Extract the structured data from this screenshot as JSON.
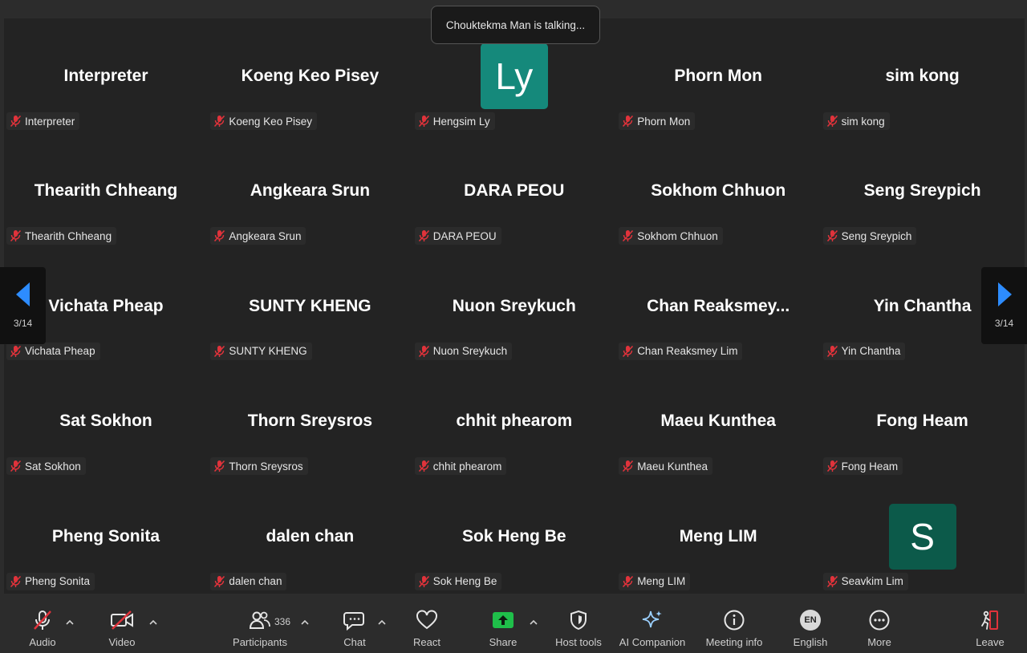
{
  "toast": {
    "text": "Chouktekma Man is talking..."
  },
  "nav": {
    "page_indicator": "3/14"
  },
  "participants": [
    {
      "display": "Interpreter",
      "tag": "Interpreter"
    },
    {
      "display": "Koeng Keo Pisey",
      "tag": "Koeng Keo Pisey"
    },
    {
      "display": "",
      "avatar": "Ly",
      "avatar_color": "#15897b",
      "tag": "Hengsim Ly"
    },
    {
      "display": "Phorn Mon",
      "tag": "Phorn Mon"
    },
    {
      "display": "sim kong",
      "tag": "sim kong"
    },
    {
      "display": "Thearith Chheang",
      "tag": "Thearith Chheang"
    },
    {
      "display": "Angkeara Srun",
      "tag": "Angkeara Srun"
    },
    {
      "display": "DARA PEOU",
      "tag": "DARA PEOU"
    },
    {
      "display": "Sokhom Chhuon",
      "tag": "Sokhom Chhuon"
    },
    {
      "display": "Seng Sreypich",
      "tag": "Seng Sreypich"
    },
    {
      "display": "Vichata Pheap",
      "tag": "Vichata Pheap"
    },
    {
      "display": "SUNTY KHENG",
      "tag": "SUNTY KHENG"
    },
    {
      "display": "Nuon Sreykuch",
      "tag": "Nuon Sreykuch"
    },
    {
      "display": "Chan  Reaksmey...",
      "tag": "Chan Reaksmey Lim"
    },
    {
      "display": "Yin Chantha",
      "tag": "Yin Chantha"
    },
    {
      "display": "Sat Sokhon",
      "tag": "Sat Sokhon"
    },
    {
      "display": "Thorn Sreysros",
      "tag": "Thorn Sreysros"
    },
    {
      "display": "chhit phearom",
      "tag": "chhit phearom"
    },
    {
      "display": "Maeu Kunthea",
      "tag": "Maeu Kunthea"
    },
    {
      "display": "Fong Heam",
      "tag": "Fong Heam"
    },
    {
      "display": "Pheng Sonita",
      "tag": "Pheng Sonita"
    },
    {
      "display": "dalen chan",
      "tag": "dalen chan"
    },
    {
      "display": "Sok Heng Be",
      "tag": "Sok Heng Be"
    },
    {
      "display": "Meng LIM",
      "tag": "Meng LIM"
    },
    {
      "display": "",
      "avatar": "S",
      "avatar_color": "#0c5a4a",
      "tag": "Seavkim Lim"
    }
  ],
  "toolbar": {
    "audio": "Audio",
    "video": "Video",
    "participants": "Participants",
    "participants_count": "336",
    "chat": "Chat",
    "react": "React",
    "share": "Share",
    "host_tools": "Host tools",
    "ai_companion": "AI Companion",
    "meeting_info": "Meeting info",
    "language": "English",
    "language_badge": "EN",
    "more": "More",
    "leave": "Leave"
  },
  "colors": {
    "share_green": "#1fbf4a",
    "muted_red": "#e0333b",
    "nav_blue": "#2d8cff"
  }
}
